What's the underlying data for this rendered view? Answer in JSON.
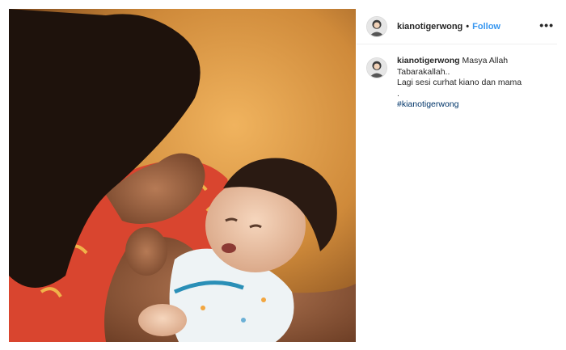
{
  "post": {
    "username": "kianotigerwong",
    "separator": "•",
    "follow_label": "Follow",
    "more_icon": "•••"
  },
  "caption": {
    "username": "kianotigerwong",
    "line1": "Masya Allah",
    "line2": "Tabarakallah..",
    "line3": "Lagi sesi curhat kiano dan mama",
    "line4": ".",
    "hashtag": "#kianotigerwong"
  },
  "colors": {
    "link_blue": "#3897f0",
    "hashtag": "#003569",
    "text": "#262626",
    "border": "#efefef"
  }
}
